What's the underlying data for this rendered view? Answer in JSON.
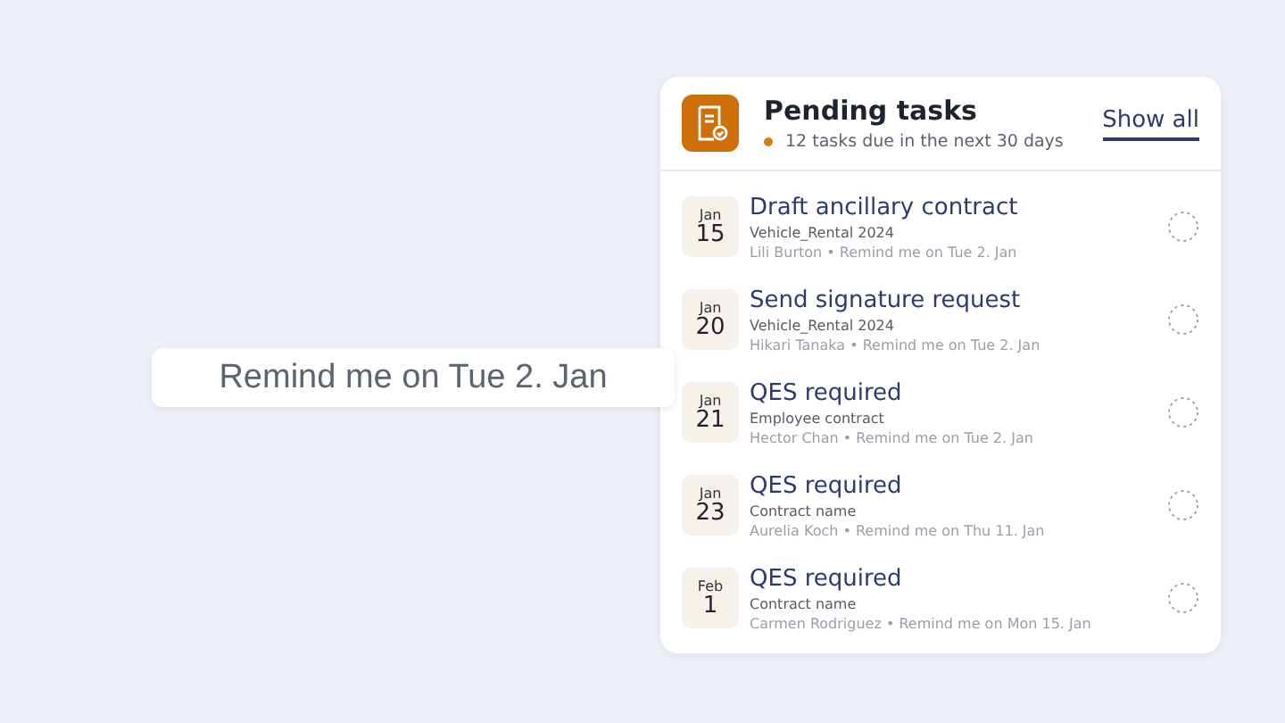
{
  "callout": {
    "text": "Remind me on Tue 2. Jan"
  },
  "card": {
    "title": "Pending tasks",
    "subtitle": "12 tasks due in the next 30 days",
    "action": "Show all",
    "tasks": [
      {
        "month": "Jan",
        "day": "15",
        "title": "Draft ancillary contract",
        "contract": "Vehicle_Rental 2024",
        "meta": "Lili Burton • Remind me on Tue 2. Jan",
        "checked": false
      },
      {
        "month": "Jan",
        "day": "20",
        "title": "Send signature request",
        "contract": "Vehicle_Rental 2024",
        "meta": "Hikari Tanaka • Remind me on Tue 2. Jan",
        "checked": false
      },
      {
        "month": "Jan",
        "day": "21",
        "title": "QES required",
        "contract": "Employee contract",
        "meta": "Hector Chan • Remind me on Tue 2. Jan",
        "checked": false
      },
      {
        "month": "Jan",
        "day": "23",
        "title": "QES required",
        "contract": "Contract name",
        "meta": "Aurelia Koch • Remind me on Thu 11. Jan",
        "checked": false
      },
      {
        "month": "Feb",
        "day": "1",
        "title": "QES required",
        "contract": "Contract name",
        "meta": "Carmen Rodriguez • Remind me on Mon 15. Jan",
        "checked": false
      }
    ]
  }
}
